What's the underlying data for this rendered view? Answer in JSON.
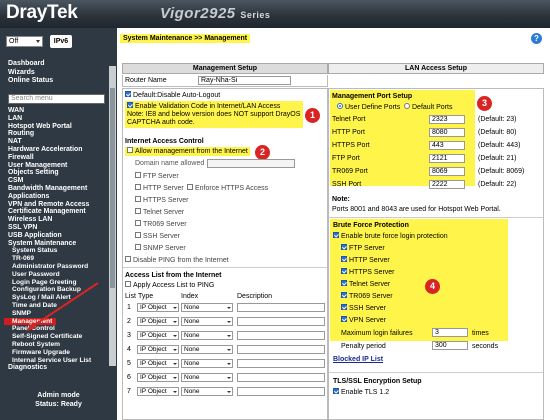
{
  "header": {
    "logo": "DrayTek",
    "model": "Vigor2925",
    "series": "Series"
  },
  "sidebar": {
    "mode_select": "Off",
    "ipv_button": "IPv6",
    "top_links": [
      "Dashboard",
      "Wizards",
      "Online Status"
    ],
    "search_placeholder": "Search menu",
    "menu": [
      {
        "label": "WAN"
      },
      {
        "label": "LAN"
      },
      {
        "label": "Hotspot Web Portal"
      },
      {
        "label": "Routing"
      },
      {
        "label": "NAT"
      },
      {
        "label": "Hardware Acceleration"
      },
      {
        "label": "Firewall"
      },
      {
        "label": "User Management"
      },
      {
        "label": "Objects Setting"
      },
      {
        "label": "CSM"
      },
      {
        "label": "Bandwidth Management"
      },
      {
        "label": "Applications"
      },
      {
        "label": "VPN and Remote Access"
      },
      {
        "label": "Certificate Management"
      },
      {
        "label": "Wireless LAN"
      },
      {
        "label": "SSL VPN"
      },
      {
        "label": "USB Application"
      },
      {
        "label": "System Maintenance"
      }
    ],
    "submenu": [
      "System Status",
      "TR-069",
      "Administrator Password",
      "User Password",
      "Login Page Greeting",
      "Configuration Backup",
      "SysLog / Mail Alert",
      "Time and Date",
      "SNMP",
      "Management",
      "Panel Control",
      "Self-Signed Certificate",
      "Reboot System",
      "Firmware Upgrade",
      "Internal Service User List"
    ],
    "active_item": "Management",
    "after_menu": "Diagnostics",
    "admin_mode": "Admin mode",
    "status": "Status: Ready"
  },
  "content": {
    "breadcrumb": "System Maintenance >> Management",
    "help_icon": "?",
    "tabs": [
      "Management Setup",
      "LAN Access Setup"
    ],
    "router_name_label": "Router Name",
    "router_name_value": "Ray-Nha-Si",
    "left": {
      "default_auto_logout": "Default:Disable Auto-Logout",
      "enable_validation": "Enable Validation Code in Internet/LAN Access",
      "note": "Note: IE8 and below version does NOT support DrayOS CAPTCHA auth code.",
      "internet_access_title": "Internet Access Control",
      "allow_mgmt": "Allow management from the Internet",
      "domain_label": "Domain name allowed",
      "servers": [
        "FTP Server",
        "HTTP Server",
        "HTTPS Server",
        "Telnet Server",
        "TR069 Server",
        "SSH Server",
        "SNMP Server"
      ],
      "enforce_https": "Enforce HTTPS Access",
      "disable_ping": "Disable PING from the Internet",
      "access_list_title": "Access List from the Internet",
      "apply_access": "Apply Access List to PING",
      "list_headers": [
        "List",
        "Type",
        "Index",
        "Description"
      ],
      "rows": [
        {
          "num": "1",
          "type": "IP Object",
          "index": "None"
        },
        {
          "num": "2",
          "type": "IP Object",
          "index": "None"
        },
        {
          "num": "3",
          "type": "IP Object",
          "index": "None"
        },
        {
          "num": "4",
          "type": "IP Object",
          "index": "None"
        },
        {
          "num": "5",
          "type": "IP Object",
          "index": "None"
        },
        {
          "num": "6",
          "type": "IP Object",
          "index": "None"
        },
        {
          "num": "7",
          "type": "IP Object",
          "index": "None"
        }
      ]
    },
    "right": {
      "port_title": "Management Port Setup",
      "user_define": "User Define Ports",
      "default_ports": "Default Ports",
      "ports": [
        {
          "label": "Telnet Port",
          "value": "2323",
          "default": "(Default: 23)"
        },
        {
          "label": "HTTP Port",
          "value": "8080",
          "default": "(Default: 80)"
        },
        {
          "label": "HTTPS Port",
          "value": "443",
          "default": "(Default: 443)"
        },
        {
          "label": "FTP Port",
          "value": "2121",
          "default": "(Default: 21)"
        },
        {
          "label": "TR069 Port",
          "value": "8069",
          "default": "(Default: 8069)"
        },
        {
          "label": "SSH Port",
          "value": "2222",
          "default": "(Default: 22)"
        }
      ],
      "note_label": "Note:",
      "note_text": "Ports 8001 and 8043 are used for Hotspot Web Portal.",
      "bfp_title": "Brute Force Protection",
      "bfp_enable": "Enable brute force login protection",
      "bfp_servers": [
        "FTP Server",
        "HTTP Server",
        "HTTPS Server",
        "Telnet Server",
        "TR069 Server",
        "SSH Server",
        "VPN Server"
      ],
      "max_failures_label": "Maximum login failures",
      "max_failures_value": "3",
      "max_failures_unit": "times",
      "penalty_label": "Penalty period",
      "penalty_value": "300",
      "penalty_unit": "seconds",
      "blocked_ip": "Blocked IP List",
      "tls_title": "TLS/SSL Encryption Setup",
      "tls_enable": "Enable TLS 1.2"
    },
    "badges": [
      "1",
      "2",
      "3",
      "4"
    ]
  },
  "colors": {
    "highlight": "#fff54a",
    "badge": "#d92424",
    "sidebar_bg": "#2f3943",
    "active": "#cc1e1e"
  }
}
